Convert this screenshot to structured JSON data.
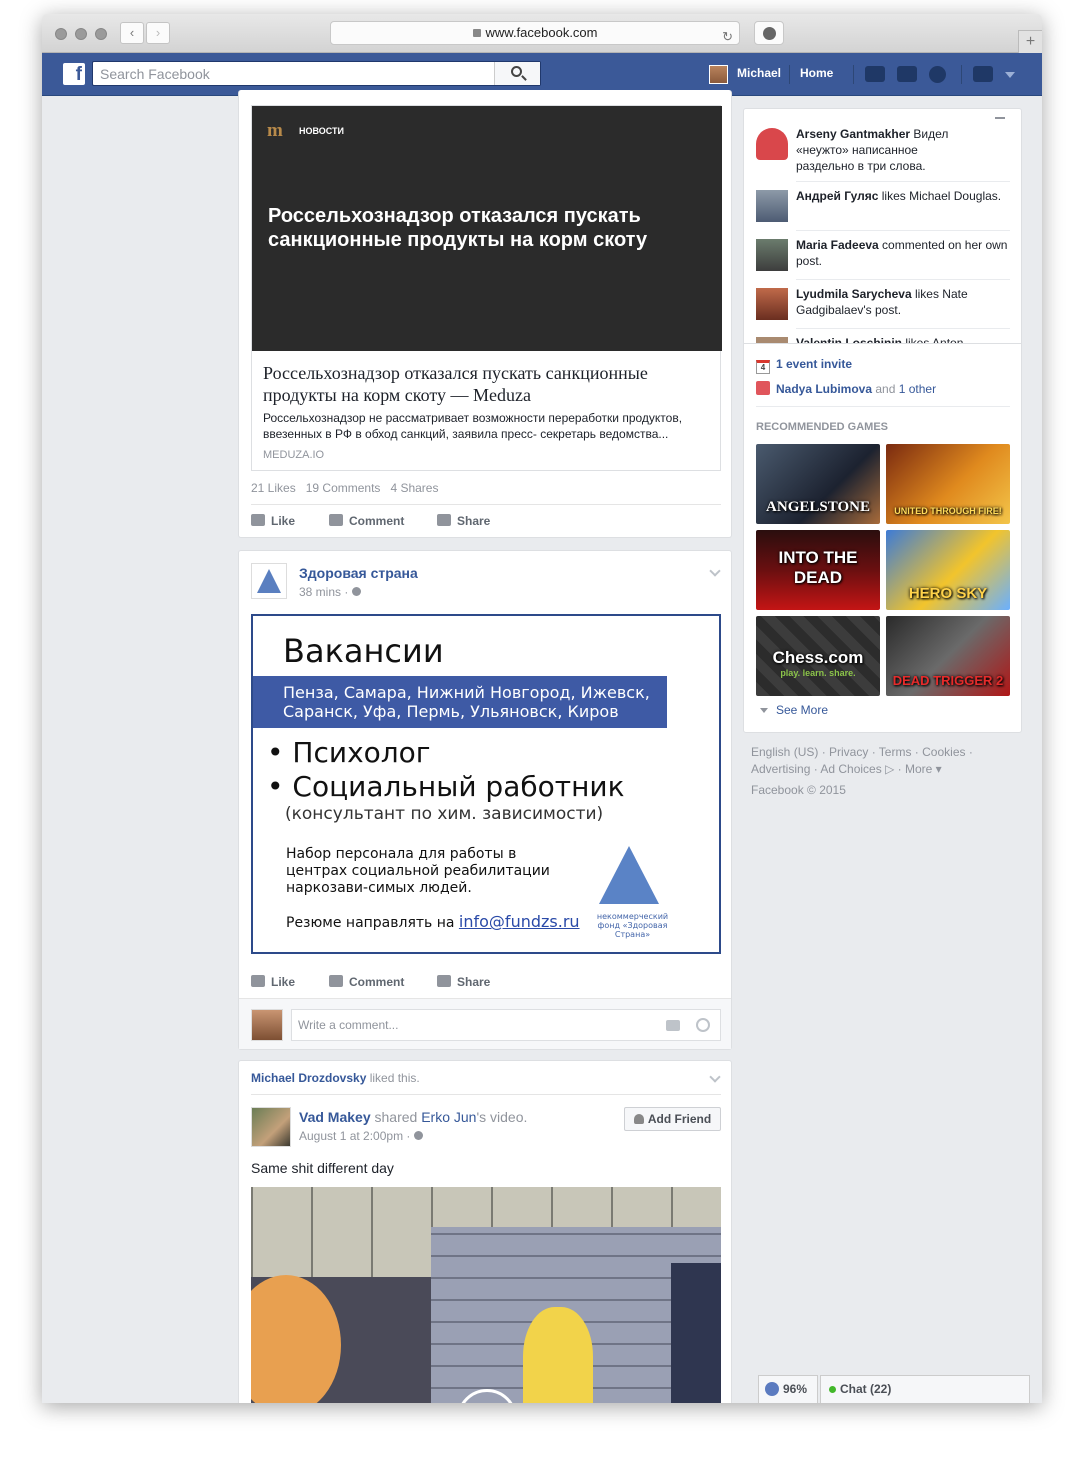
{
  "browser": {
    "url": "www.facebook.com",
    "back": "‹",
    "forward": "›",
    "newtab": "+"
  },
  "topbar": {
    "logo": "f",
    "search_placeholder": "Search Facebook",
    "user": "Michael",
    "home": "Home"
  },
  "post1": {
    "image_brand": "m",
    "image_section": "НОВОСТИ",
    "image_headline": "Россельхознадзор отказался пускать санкционные продукты на корм скоту",
    "link_title": "Россельхознадзор отказался пускать санкционные продукты на корм скоту — Meduza",
    "link_desc": "Россельхознадзор не рассматривает возможности переработки продуктов, ввезенных в РФ в обход санкций, заявила пресс- секретарь ведомства...",
    "link_domain": "MEDUZA.IO",
    "likes": "21 Likes",
    "comments": "19 Comments",
    "shares": "4 Shares"
  },
  "actions": {
    "like": "Like",
    "comment": "Comment",
    "share": "Share"
  },
  "post2": {
    "author": "Здоровая страна",
    "time": "38 mins · ",
    "img_title": "Вакансии",
    "img_cities": "Пенза, Самара, Нижний Новгород, Ижевск, Саранск, Уфа, Пермь, Ульяновск, Киров",
    "img_job1": "• Психолог",
    "img_job2": "• Социальный работник",
    "img_job2_note": "(консультант по хим. зависимости)",
    "img_text": "Набор персонала для работы в центрах социальной реабилитации наркозави-симых людей.",
    "img_resume": "Резюме направлять на ",
    "img_email": "info@fundzs.ru",
    "img_logo_text": "некоммерческий фонд «Здоровая Страна»",
    "comment_placeholder": "Write a comment..."
  },
  "post3": {
    "liker": "Michael Drozdovsky",
    "liked_text": " liked this.",
    "author": "Vad Makey",
    "shared": " shared ",
    "source": "Erko Jun",
    "source_suffix": "'s video.",
    "time": "August 1 at 2:00pm · ",
    "add_friend": "Add Friend",
    "text": "Same shit different day"
  },
  "ticker": [
    {
      "name": "Arseny Gantmakher",
      "text": " Видел «неужто» написанное раздельно в три слова."
    },
    {
      "name": "Андрей Гуляс",
      "text": " likes Michael Douglas."
    },
    {
      "name": "Maria Fadeeva",
      "text": " commented on her own post."
    },
    {
      "name": "Lyudmila Sarycheva",
      "text": " likes Nate Gadgibalaev's post."
    },
    {
      "name": "Valentin Loschinin",
      "text": " likes Anton"
    }
  ],
  "sidebar": {
    "event_icon_num": "4",
    "event_invite": "1 event invite",
    "birthday_name": "Nadya Lubimova",
    "birthday_and": " and ",
    "birthday_other": "1 other",
    "rec_games": "RECOMMENDED GAMES",
    "see_more": "See More",
    "games": [
      "ANGELSTONE",
      "UNITED THROUGH FIRE!",
      "INTO THE DEAD",
      "HERO SKY",
      "Chess.com",
      "DEAD TRIGGER 2"
    ],
    "chess_tagline": "play. learn. share."
  },
  "footer": {
    "line1": "English (US) · Privacy · Terms · Cookies ·",
    "line2": "Advertising · Ad Choices ▷ · More ▾",
    "line3": "Facebook © 2015"
  },
  "chat": {
    "percent": "96%",
    "label": "Chat (22)"
  }
}
